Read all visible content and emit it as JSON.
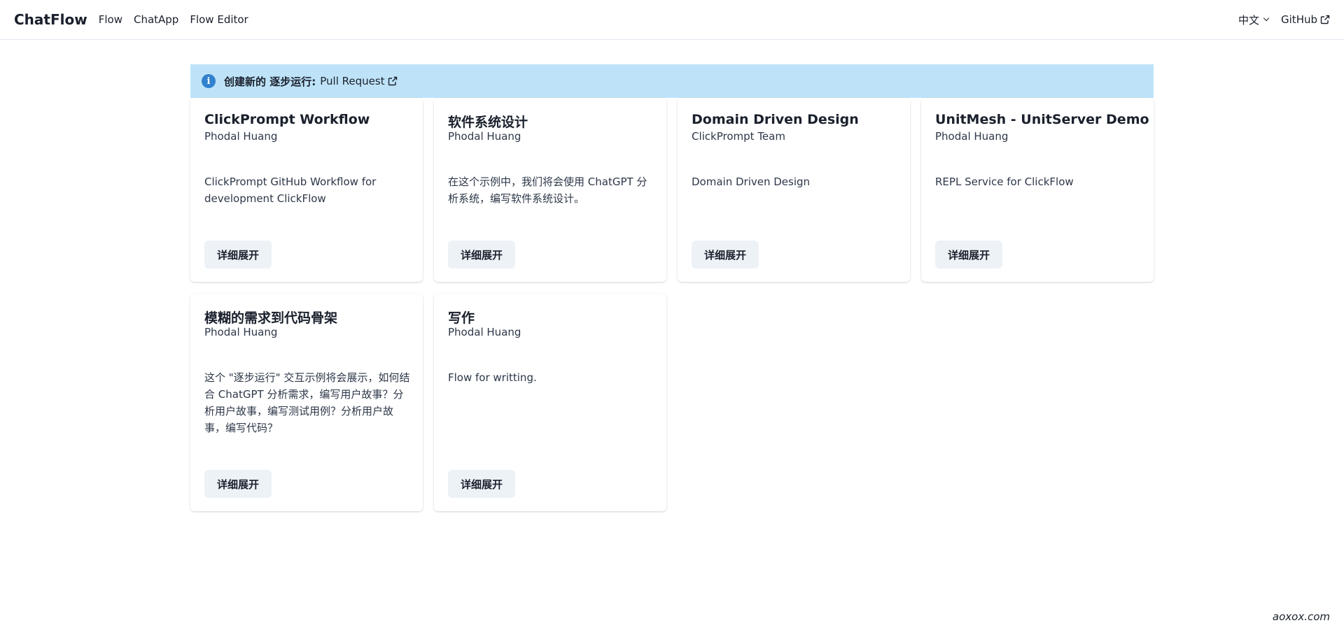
{
  "nav": {
    "brand": "ChatFlow",
    "links": [
      "Flow",
      "ChatApp",
      "Flow Editor"
    ],
    "language": "中文",
    "github": "GitHub"
  },
  "alert": {
    "title": "创建新的 逐步运行:",
    "link": "Pull Request"
  },
  "cards": [
    {
      "title": "ClickPrompt Workflow",
      "author": "Phodal Huang",
      "description": "ClickPrompt GitHub Workflow for development ClickFlow",
      "button": "详细展开"
    },
    {
      "title": "软件系统设计",
      "author": "Phodal Huang",
      "description": "在这个示例中，我们将会使用 ChatGPT 分析系统，编写软件系统设计。",
      "button": "详细展开"
    },
    {
      "title": "Domain Driven Design",
      "author": "ClickPrompt Team",
      "description": "Domain Driven Design",
      "button": "详细展开"
    },
    {
      "title": "UnitMesh - UnitServer Demo",
      "author": "Phodal Huang",
      "description": "REPL Service for ClickFlow",
      "button": "详细展开"
    },
    {
      "title": "模糊的需求到代码骨架",
      "author": "Phodal Huang",
      "description": "这个 \"逐步运行\" 交互示例将会展示，如何结合 ChatGPT 分析需求，编写用户故事？分析用户故事，编写测试用例？分析用户故事，编写代码？",
      "button": "详细展开"
    },
    {
      "title": "写作",
      "author": "Phodal Huang",
      "description": "Flow for writting.",
      "button": "详细展开"
    }
  ],
  "watermark": "aoxox.com",
  "colors": {
    "alert_bg": "#bee3f8",
    "info_icon": "#3182ce",
    "button_bg": "#edf2f7"
  }
}
